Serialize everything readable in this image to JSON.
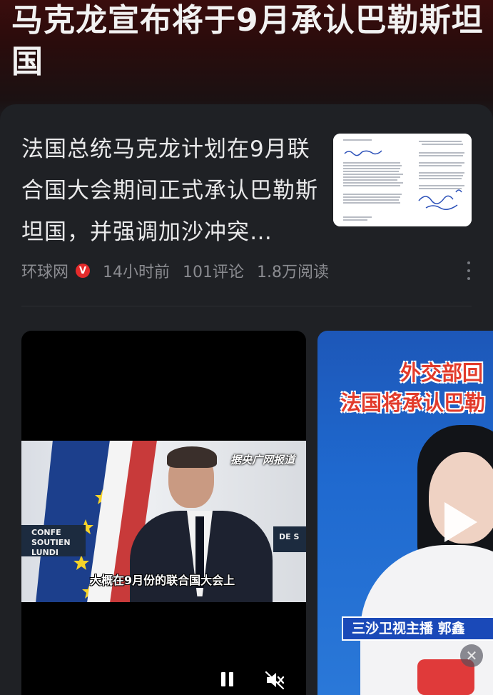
{
  "top_title": "马克龙宣布将于9月承认巴勒斯坦国",
  "article": {
    "headline": "法国总统马克龙计划在9月联合国大会期间正式承认巴勒斯坦国，并强调加沙冲突…",
    "source": "环球网",
    "verified_badge": "V",
    "time": "14小时前",
    "comments": "101评论",
    "reads": "1.8万阅读"
  },
  "video_main": {
    "news_tag": "据央广网报道",
    "subtitle": "大概在9月份的联合国大会上",
    "stage_sign_left": "CONFE SOUTIEN LUNDI",
    "stage_sign_right": "DE S"
  },
  "video_second": {
    "title_line1": "外交部回",
    "title_line2": "法国将承认巴勒",
    "anchor_bar": "三沙卫视主播 郭鑫"
  },
  "icons": {
    "verified": "verified-icon",
    "more": "more-vertical-icon",
    "pause": "pause-icon",
    "mute": "mute-icon",
    "play": "play-icon",
    "close": "close-icon"
  },
  "colors": {
    "background": "#1a1c20",
    "card": "#1f2125",
    "accent_red": "#e52b2b",
    "meta_text": "#8a8b90"
  }
}
